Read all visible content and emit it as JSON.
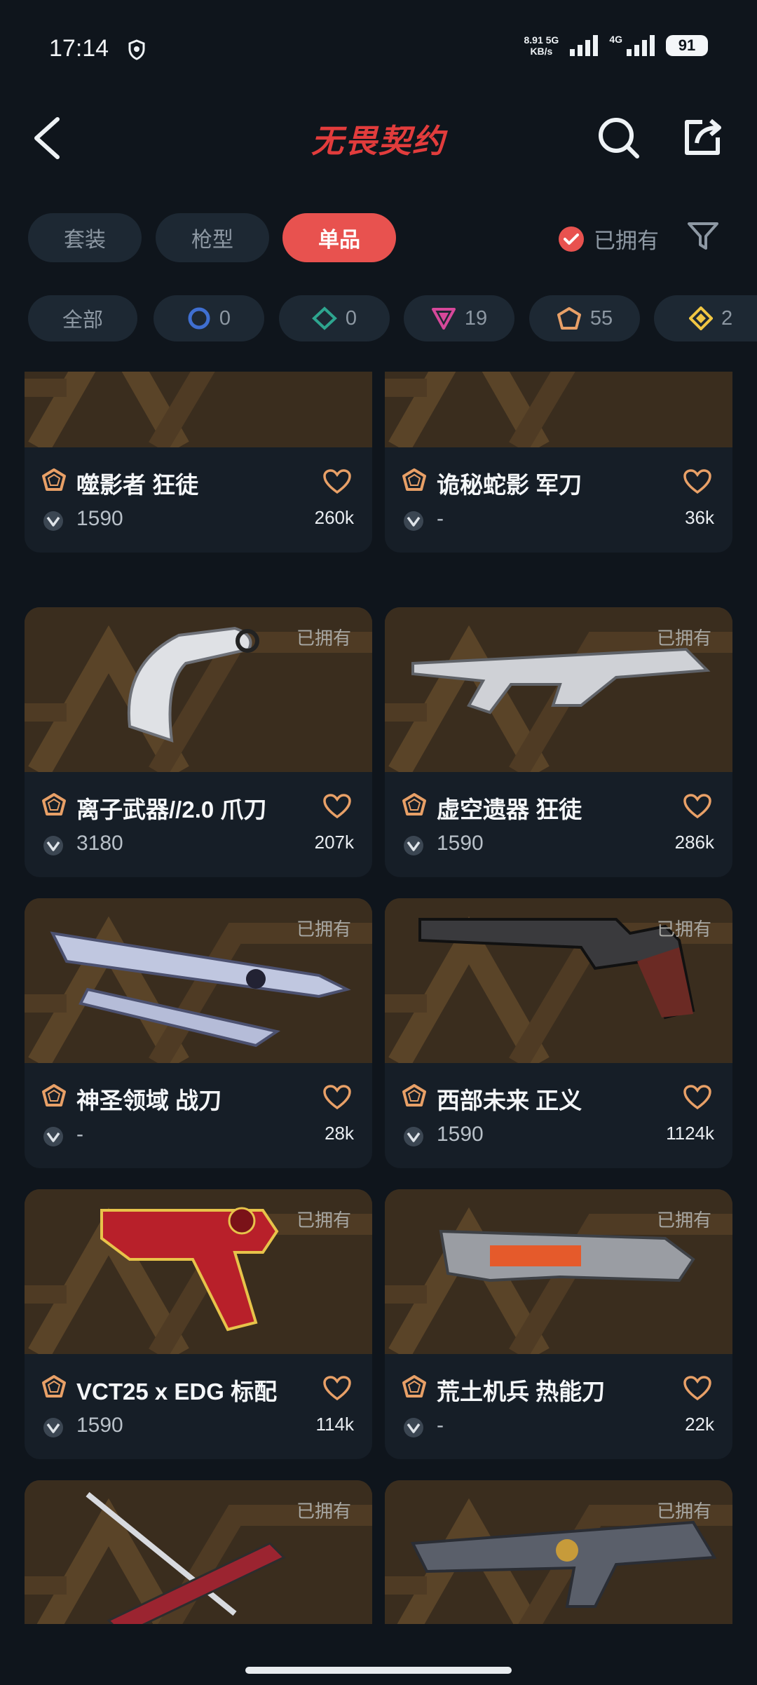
{
  "status_bar": {
    "time": "17:14",
    "net_speed_value": "8.91",
    "net_speed_unit": "KB/s",
    "sig1": "5G",
    "sig2": "4G",
    "battery": "91"
  },
  "header": {
    "title": "无畏契约",
    "icons": [
      "back-icon",
      "search-icon",
      "share-icon"
    ]
  },
  "tabs": [
    {
      "label": "套装",
      "active": false
    },
    {
      "label": "枪型",
      "active": false
    },
    {
      "label": "单品",
      "active": true
    }
  ],
  "owned_filter_label": "已拥有",
  "chips": [
    {
      "label": "全部"
    },
    {
      "count": "0",
      "icon": "select-tier-icon"
    },
    {
      "count": "0",
      "icon": "deluxe-tier-icon"
    },
    {
      "count": "19",
      "icon": "premium-tier-icon"
    },
    {
      "count": "55",
      "icon": "exclusive-tier-icon"
    },
    {
      "count": "2",
      "icon": "ultra-tier-icon"
    }
  ],
  "items": [
    {
      "name": "噬影者 狂徒",
      "price": "1590",
      "likes": "260k",
      "owned": false
    },
    {
      "name": "诡秘蛇影 军刀",
      "price": "-",
      "likes": "36k",
      "owned": false
    },
    {
      "name": "离子武器//2.0 爪刀",
      "price": "3180",
      "likes": "207k",
      "owned": true
    },
    {
      "name": "虚空遗器 狂徒",
      "price": "1590",
      "likes": "286k",
      "owned": true
    },
    {
      "name": "神圣领域 战刀",
      "price": "-",
      "likes": "28k",
      "owned": true
    },
    {
      "name": "西部未来 正义",
      "price": "1590",
      "likes": "1124k",
      "owned": true
    },
    {
      "name": "VCT25 x EDG 标配",
      "price": "1590",
      "likes": "114k",
      "owned": true
    },
    {
      "name": "荒土机兵 热能刀",
      "price": "-",
      "likes": "22k",
      "owned": true
    },
    {
      "name": "",
      "price": "",
      "likes": "",
      "owned": true
    },
    {
      "name": "",
      "price": "",
      "likes": "",
      "owned": true
    }
  ],
  "owned_tag": "已拥有",
  "colors": {
    "accent": "#e8524f",
    "tier_exclusive": "#e8a067"
  }
}
